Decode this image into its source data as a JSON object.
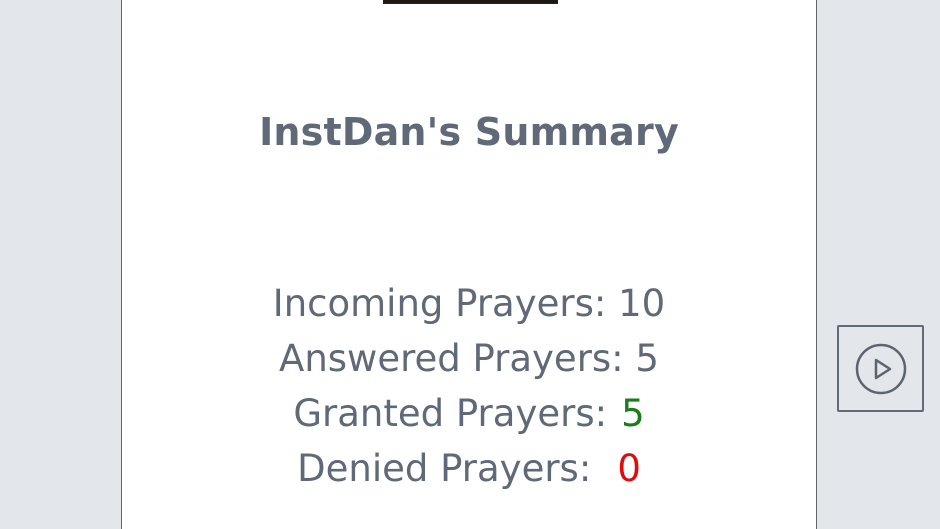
{
  "summary": {
    "title": "InstDan's Summary",
    "incoming_label": "Incoming Prayers:",
    "incoming_value": "10",
    "answered_label": "Answered Prayers:",
    "answered_value": "5",
    "granted_label": "Granted Prayers:",
    "granted_value": "5",
    "denied_label": "Denied Prayers:",
    "denied_value": "0"
  },
  "side_button": {
    "icon": "play-circle-icon"
  },
  "colors": {
    "text": "#5f6977",
    "granted": "#1a7d1a",
    "denied": "#e00b0b",
    "page_background": "#e3e7ec",
    "panel_background": "#ffffff"
  }
}
